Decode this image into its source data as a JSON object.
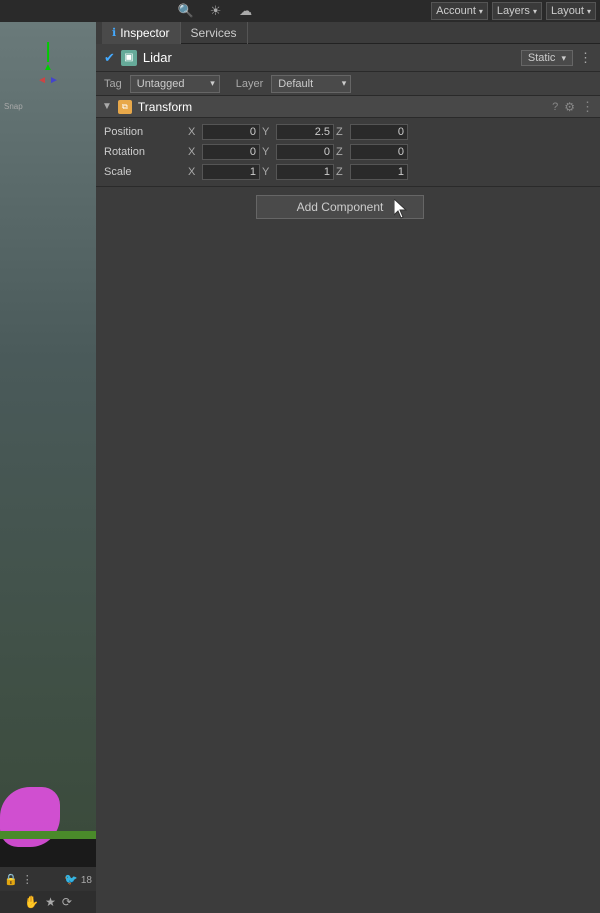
{
  "topbar": {
    "search_icon": "🔍",
    "sun_icon": "☀",
    "cloud_icon": "☁",
    "account_label": "Account",
    "layers_label": "Layers",
    "layout_label": "Layout",
    "account_arrow": "▾",
    "layers_arrow": "▾",
    "layout_arrow": "▾"
  },
  "tabs": {
    "inspector_label": "Inspector",
    "services_label": "Services"
  },
  "object": {
    "name": "Lidar",
    "tag_label": "Tag",
    "tag_value": "Untagged",
    "layer_label": "Layer",
    "layer_value": "Default",
    "static_label": "Static"
  },
  "transform": {
    "component_name": "Transform",
    "position_label": "Position",
    "rotation_label": "Rotation",
    "scale_label": "Scale",
    "position": {
      "x": "0",
      "y": "2.5",
      "z": "0"
    },
    "rotation": {
      "x": "0",
      "y": "0",
      "z": "0"
    },
    "scale": {
      "x": "1",
      "y": "1",
      "z": "1"
    }
  },
  "add_component": {
    "label": "Add Component"
  },
  "scene": {
    "count": "18"
  }
}
